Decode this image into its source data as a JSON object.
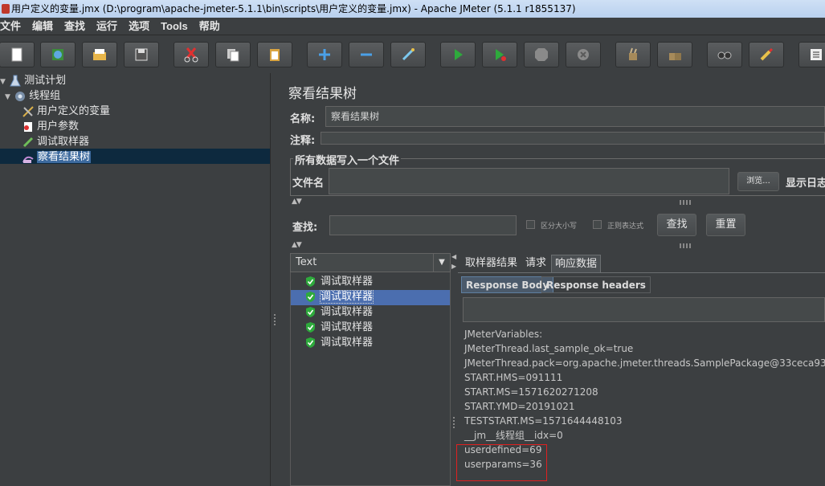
{
  "window": {
    "title": "用户定义的变量.jmx (D:\\program\\apache-jmeter-5.1.1\\bin\\scripts\\用户定义的变量.jmx) - Apache JMeter (5.1.1 r1855137)"
  },
  "menu": [
    "文件",
    "编辑",
    "查找",
    "运行",
    "选项",
    "Tools",
    "帮助"
  ],
  "toolbar": {
    "icons": [
      "new-icon",
      "templates-icon",
      "open-icon",
      "save-icon",
      "cut-icon",
      "copy-icon",
      "paste-icon",
      "expand-icon",
      "collapse-icon",
      "toggle-icon",
      "start-icon",
      "start-no-pause-icon",
      "stop-icon",
      "shutdown-icon",
      "clear-icon",
      "clear-all-icon",
      "search-icon",
      "reset-search-icon",
      "function-helper-icon"
    ]
  },
  "tree": [
    {
      "label": "测试计划",
      "icon": "test-plan-icon"
    },
    {
      "label": "线程组",
      "icon": "thread-group-icon"
    },
    {
      "label": "用户定义的变量",
      "icon": "user-defined-variables-icon"
    },
    {
      "label": "用户参数",
      "icon": "user-parameters-icon"
    },
    {
      "label": "调试取样器",
      "icon": "debug-sampler-icon"
    },
    {
      "label": "察看结果树",
      "icon": "view-results-tree-icon",
      "selected": true
    }
  ],
  "panel": {
    "title": "察看结果树",
    "name_label": "名称:",
    "name_value": "察看结果树",
    "comment_label": "注释:",
    "file_group_title": "所有数据写入一个文件",
    "filename_label": "文件名",
    "browse_button": "浏览...",
    "log_display_label": "显示日志",
    "search_label": "查找:",
    "case_sensitive_label": "区分大小写",
    "regex_label": "正则表达式",
    "search_button": "查找",
    "reset_button": "重置"
  },
  "results": {
    "renderer": "Text",
    "items": [
      "调试取样器",
      "调试取样器",
      "调试取样器",
      "调试取样器",
      "调试取样器"
    ],
    "selected_index": 1
  },
  "tabs": [
    "取样器结果",
    "请求",
    "响应数据"
  ],
  "active_tab": "响应数据",
  "subtabs": [
    "Response Body",
    "Response headers"
  ],
  "active_subtab": "Response Body",
  "response_lines": [
    "JMeterVariables:",
    "JMeterThread.last_sample_ok=true",
    "JMeterThread.pack=org.apache.jmeter.threads.SamplePackage@33ceca93",
    "START.HMS=091111",
    "START.MS=1571620271208",
    "START.YMD=20191021",
    "TESTSTART.MS=1571644448103",
    "__jm__线程组__idx=0",
    "userdefined=69",
    "userparams=36"
  ],
  "colors": {
    "background": "#3c3f41",
    "selection": "#0d293e",
    "highlight_box": "#e02020",
    "success_icon": "#2eaa3c"
  }
}
